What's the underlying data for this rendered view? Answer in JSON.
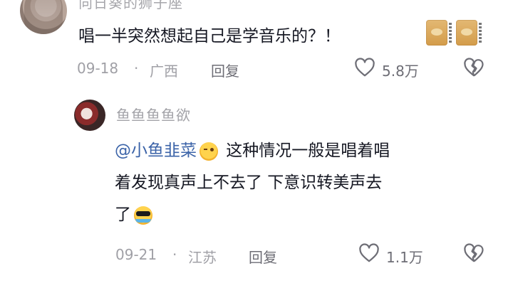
{
  "main_comment": {
    "username": "向日葵的狮子座",
    "text": "唱一半突然想起自己是学音乐的？！",
    "emojis": [
      "cat-emoji",
      "cat-emoji"
    ],
    "date": "09-18",
    "separator": "·",
    "location": "广西",
    "reply_label": "回复",
    "like_count": "5.8万"
  },
  "reply_comment": {
    "username": "鱼鱼鱼鱼欲",
    "mention": "@小鱼韭菜",
    "text_line1": " 这种情况一般是唱着唱",
    "text_line2": "着发现真声上不去了 下意识转美声去",
    "text_line3": "了",
    "date": "09-21",
    "separator": "·",
    "location": "江苏",
    "reply_label": "回复",
    "like_count": "1.1万"
  },
  "icons": {
    "like": "heart-outline-icon",
    "dislike": "broken-heart-icon",
    "wink": "wink-emoji-icon",
    "cool": "sunglasses-emoji-icon"
  },
  "colors": {
    "text": "#161823",
    "meta": "#a0a0a6",
    "mention": "#3b63a8"
  }
}
